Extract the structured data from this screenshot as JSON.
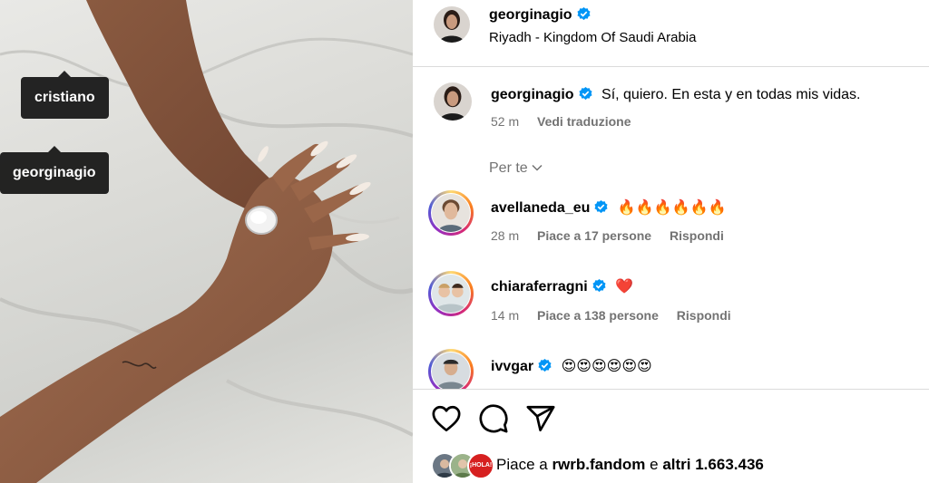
{
  "post": {
    "username": "georginagio",
    "location": "Riyadh - Kingdom Of Saudi Arabia",
    "tags": [
      "cristiano",
      "georginagio"
    ]
  },
  "caption": {
    "username": "georginagio",
    "text": "Sí, quiero. En esta y en todas mis vidas.",
    "time": "52 m",
    "translate": "Vedi traduzione"
  },
  "filter": {
    "label": "Per te",
    "icon": "chevron-down-icon"
  },
  "comments": [
    {
      "username": "avellaneda_eu",
      "text": "🔥🔥🔥🔥🔥🔥",
      "time": "28 m",
      "likes": "Piace a 17 persone",
      "reply": "Rispondi"
    },
    {
      "username": "chiaraferragni",
      "text": "❤️",
      "time": "14 m",
      "likes": "Piace a 138 persone",
      "reply": "Rispondi"
    },
    {
      "username": "ivvgar",
      "text": "😍😍😍😍😍😍"
    }
  ],
  "actions": {
    "like": "heart-icon",
    "comment": "comment-icon",
    "share": "share-icon"
  },
  "likes": {
    "prefix": "Piace a",
    "user": "rwrb.fandom",
    "middle": "e",
    "others": "altri 1.663.436",
    "badge_text": "¡HOLA!"
  },
  "colors": {
    "verified": "#0095f6",
    "secondary_text": "#737373",
    "divider": "#dbdbdb"
  }
}
